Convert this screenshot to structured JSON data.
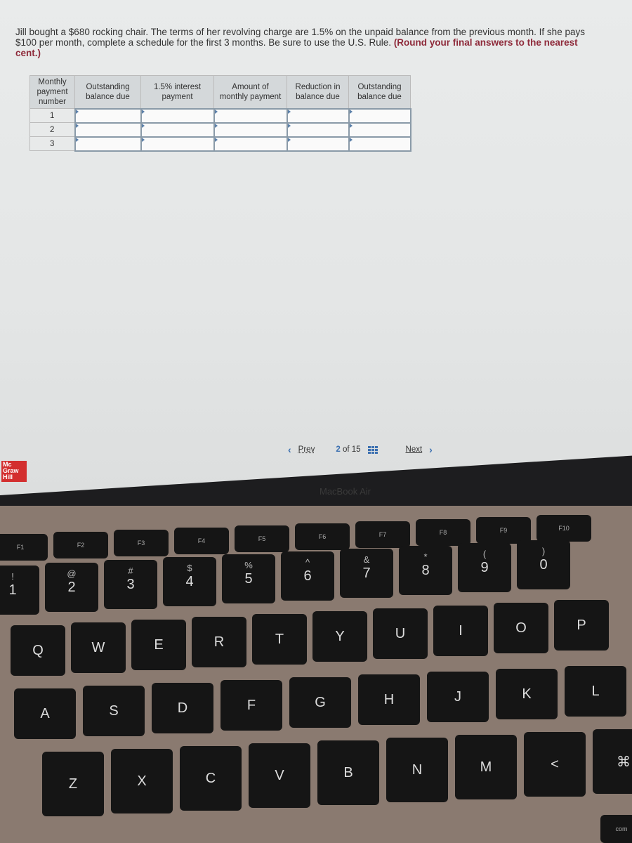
{
  "question": {
    "text": "Jill bought a $680 rocking chair. The terms of her revolving charge are 1.5% on the unpaid balance from the previous month. If she pays $100 per month, complete a schedule for the first 3 months. Be sure to use the U.S. Rule.",
    "instruction": "(Round your final answers to the nearest cent.)"
  },
  "table": {
    "headers": [
      "Monthly payment number",
      "Outstanding balance due",
      "1.5% interest payment",
      "Amount of monthly payment",
      "Reduction in balance due",
      "Outstanding balance due"
    ],
    "rows": [
      {
        "number": "1"
      },
      {
        "number": "2"
      },
      {
        "number": "3"
      }
    ]
  },
  "nav": {
    "prev": "Prev",
    "current": "2",
    "of": "of 15",
    "next": "Next"
  },
  "logo": "Mc Graw Hill",
  "bezel_label": "MacBook Air",
  "colors": {
    "logo": "#d32f2f",
    "nav_accent": "#3a6fb0",
    "instruction": "#8e2a3a"
  },
  "keyboard": {
    "fn": [
      "F1",
      "F2",
      "F3",
      "F4",
      "F5",
      "F6",
      "F7",
      "F8",
      "F9",
      "F10"
    ],
    "numbers": [
      [
        "!",
        "1"
      ],
      [
        "@",
        "2"
      ],
      [
        "#",
        "3"
      ],
      [
        "$",
        "4"
      ],
      [
        "%",
        "5"
      ],
      [
        "^",
        "6"
      ],
      [
        "&",
        "7"
      ],
      [
        "*",
        "8"
      ],
      [
        "(",
        "9"
      ],
      [
        ")",
        "0"
      ]
    ],
    "row_q": [
      "Q",
      "W",
      "E",
      "R",
      "T",
      "Y",
      "U",
      "I",
      "O",
      "P"
    ],
    "row_a": [
      "A",
      "S",
      "D",
      "F",
      "G",
      "H",
      "J",
      "K",
      "L"
    ],
    "row_z": [
      "Z",
      "X",
      "C",
      "V",
      "B",
      "N",
      "M",
      "<",
      "⌘"
    ],
    "command_label": "com"
  }
}
